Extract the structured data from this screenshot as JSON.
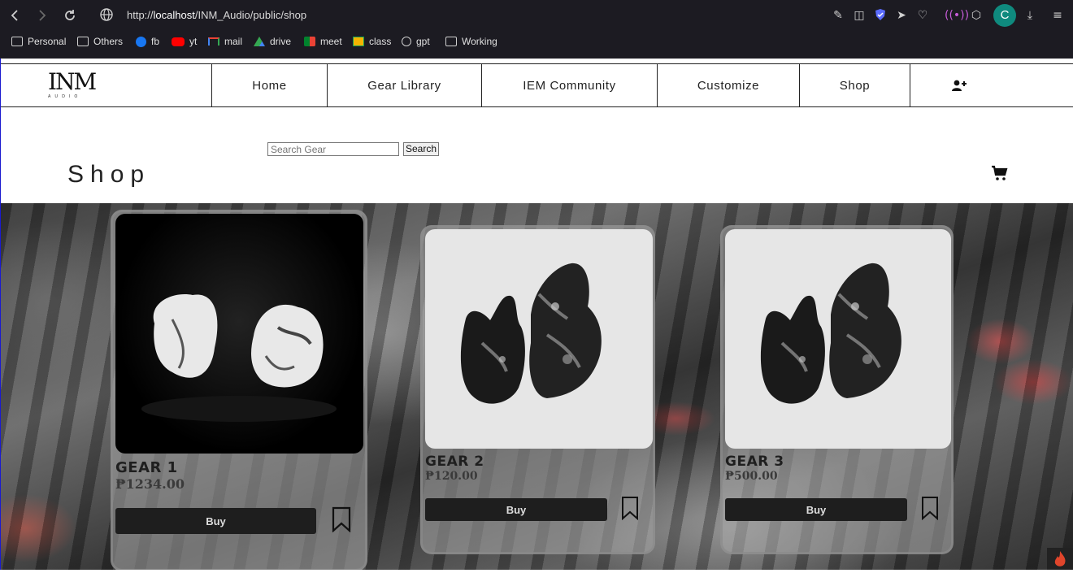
{
  "browser": {
    "url_prefix": "http://",
    "url_host": "localhost",
    "url_path": "/INM_Audio/public/shop",
    "profile_initial": "C",
    "bookmarks": [
      {
        "label": "Personal",
        "icon": "folder-icon"
      },
      {
        "label": "Others",
        "icon": "folder-icon"
      },
      {
        "label": "fb",
        "icon": "facebook-icon"
      },
      {
        "label": "yt",
        "icon": "youtube-icon"
      },
      {
        "label": "mail",
        "icon": "gmail-icon"
      },
      {
        "label": "drive",
        "icon": "drive-icon"
      },
      {
        "label": "meet",
        "icon": "meet-icon"
      },
      {
        "label": "class",
        "icon": "classroom-icon"
      },
      {
        "label": "gpt",
        "icon": "openai-icon"
      },
      {
        "label": "Working",
        "icon": "folder-icon"
      }
    ]
  },
  "site": {
    "logo_text": "INM",
    "logo_sub": "AUDIO",
    "nav": [
      {
        "label": "Home"
      },
      {
        "label": "Gear Library"
      },
      {
        "label": "IEM Community"
      },
      {
        "label": "Customize"
      },
      {
        "label": "Shop"
      }
    ]
  },
  "shop": {
    "title": "Shop",
    "search_placeholder": "Search Gear",
    "search_button": "Search"
  },
  "products": [
    {
      "name": "GEAR 1",
      "price": "₱1234.00",
      "buy_label": "Buy"
    },
    {
      "name": "GEAR 2",
      "price": "₱120.00",
      "buy_label": "Buy"
    },
    {
      "name": "GEAR 3",
      "price": "₱500.00",
      "buy_label": "Buy"
    }
  ],
  "colors": {
    "browser_bg": "#1c1b22",
    "profile": "#0f8a7e",
    "buy_button": "#1e1e1e"
  }
}
